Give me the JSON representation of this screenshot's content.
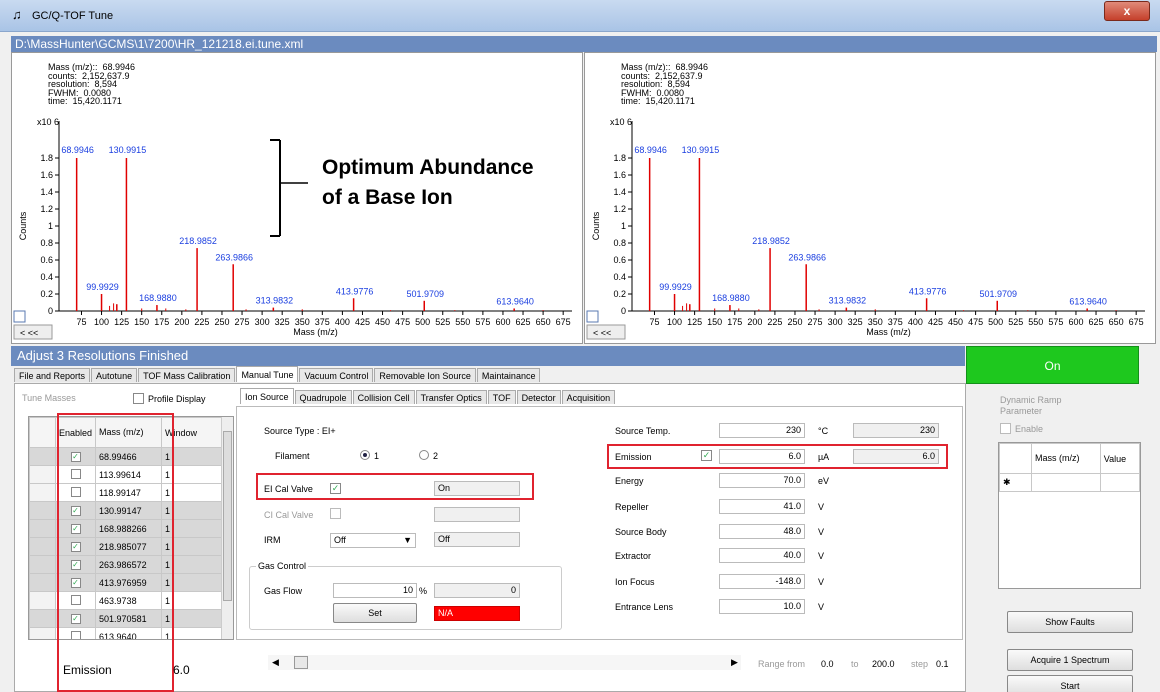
{
  "window": {
    "title": "GC/Q-TOF Tune",
    "file_path": "D:\\MassHunter\\GCMS\\1\\7200\\HR_121218.ei.tune.xml",
    "close_label": "x"
  },
  "annotation": {
    "text_line1": "Optimum Abundance",
    "text_line2": "of a Base Ion"
  },
  "plot_readout": {
    "mass": "Mass (m/z)::  68.9946",
    "counts": "counts:  2,152,637.9",
    "resolution": "resolution:  8,594",
    "fwhm": "FWHM:  0.0080",
    "time": "time:  15,420.1171"
  },
  "chart_data": [
    {
      "type": "bar",
      "xlabel": "Mass (m/z)",
      "ylabel": "Counts",
      "y_multiplier": "x10 6",
      "xlim": [
        47,
        686
      ],
      "ylim": [
        0,
        2.0
      ],
      "xticks": [
        75,
        100,
        125,
        150,
        175,
        200,
        225,
        250,
        275,
        300,
        325,
        350,
        375,
        400,
        425,
        450,
        475,
        500,
        525,
        550,
        575,
        600,
        625,
        650,
        675
      ],
      "yticks": [
        0,
        0.2,
        0.4,
        0.6,
        0.8,
        1,
        1.2,
        1.4,
        1.6,
        1.8
      ],
      "peaks": [
        {
          "x": 68.9946,
          "y": 1.8,
          "label": "68.9946"
        },
        {
          "x": 99.9929,
          "y": 0.2,
          "label": "99.9929"
        },
        {
          "x": 118.99,
          "y": 0.08
        },
        {
          "x": 130.9915,
          "y": 1.8,
          "label": "130.9915"
        },
        {
          "x": 168.988,
          "y": 0.07,
          "label": "168.9880"
        },
        {
          "x": 218.9852,
          "y": 0.74,
          "label": "218.9852"
        },
        {
          "x": 263.9866,
          "y": 0.55,
          "label": "263.9866"
        },
        {
          "x": 313.9832,
          "y": 0.04,
          "label": "313.9832"
        },
        {
          "x": 413.9776,
          "y": 0.15,
          "label": "413.9776"
        },
        {
          "x": 501.9709,
          "y": 0.12,
          "label": "501.9709"
        },
        {
          "x": 613.964,
          "y": 0.03,
          "label": "613.9640"
        }
      ]
    },
    {
      "type": "bar",
      "xlabel": "Mass (m/z)",
      "ylabel": "Counts",
      "y_multiplier": "x10 6",
      "xlim": [
        47,
        686
      ],
      "ylim": [
        0,
        2.0
      ],
      "xticks": [
        75,
        100,
        125,
        150,
        175,
        200,
        225,
        250,
        275,
        300,
        325,
        350,
        375,
        400,
        425,
        450,
        475,
        500,
        525,
        550,
        575,
        600,
        625,
        650,
        675
      ],
      "yticks": [
        0,
        0.2,
        0.4,
        0.6,
        0.8,
        1,
        1.2,
        1.4,
        1.6,
        1.8
      ],
      "peaks": [
        {
          "x": 68.9946,
          "y": 1.8,
          "label": "68.9946"
        },
        {
          "x": 99.9929,
          "y": 0.2,
          "label": "99.9929"
        },
        {
          "x": 118.99,
          "y": 0.08
        },
        {
          "x": 130.9915,
          "y": 1.8,
          "label": "130.9915"
        },
        {
          "x": 168.988,
          "y": 0.07,
          "label": "168.9880"
        },
        {
          "x": 218.9852,
          "y": 0.74,
          "label": "218.9852"
        },
        {
          "x": 263.9866,
          "y": 0.55,
          "label": "263.9866"
        },
        {
          "x": 313.9832,
          "y": 0.04,
          "label": "313.9832"
        },
        {
          "x": 413.9776,
          "y": 0.15,
          "label": "413.9776"
        },
        {
          "x": 501.9709,
          "y": 0.12,
          "label": "501.9709"
        },
        {
          "x": 613.964,
          "y": 0.03,
          "label": "613.9640"
        }
      ]
    }
  ],
  "status": {
    "message": "Adjust 3 Resolutions Finished",
    "on_label": "On"
  },
  "main_tabs": [
    "File and Reports",
    "Autotune",
    "TOF Mass Calibration",
    "Manual Tune",
    "Vacuum Control",
    "Removable Ion Source",
    "Maintainance"
  ],
  "sub_tabs": [
    "Ion Source",
    "Quadrupole",
    "Collision Cell",
    "Transfer Optics",
    "TOF",
    "Detector",
    "Acquisition"
  ],
  "tune_masses": {
    "title": "Tune Masses",
    "profile_display": "Profile Display",
    "headers": {
      "enabled": "Enabled",
      "mass": "Mass (m/z)",
      "window": "Window"
    },
    "rows": [
      {
        "enabled": true,
        "mass": "68.99466",
        "window": "1"
      },
      {
        "enabled": false,
        "mass": "113.99614",
        "window": "1"
      },
      {
        "enabled": false,
        "mass": "118.99147",
        "window": "1"
      },
      {
        "enabled": true,
        "mass": "130.99147",
        "window": "1"
      },
      {
        "enabled": true,
        "mass": "168.988266",
        "window": "1"
      },
      {
        "enabled": true,
        "mass": "218.985077",
        "window": "1"
      },
      {
        "enabled": true,
        "mass": "263.986572",
        "window": "1"
      },
      {
        "enabled": true,
        "mass": "413.976959",
        "window": "1"
      },
      {
        "enabled": false,
        "mass": "463.9738",
        "window": "1"
      },
      {
        "enabled": true,
        "mass": "501.970581",
        "window": "1"
      },
      {
        "enabled": false,
        "mass": "613.9640",
        "window": "1"
      }
    ]
  },
  "ion_source": {
    "source_type": "Source Type : EI+",
    "filament_label": "Filament",
    "filament_opt1": "1",
    "filament_opt2": "2",
    "ei_cal_valve_label": "EI Cal Valve",
    "ei_cal_valve_value": "On",
    "ci_cal_valve_label": "CI Cal Valve",
    "irm_label": "IRM",
    "irm_select": "Off",
    "irm_value": "Off",
    "gas_control": "Gas Control",
    "gas_flow_label": "Gas Flow",
    "gas_flow_value": "10",
    "gas_flow_unit": "%",
    "gas_flow_actual": "0",
    "set_label": "Set",
    "na_label": "N/A"
  },
  "params": [
    {
      "label": "Source Temp.",
      "value": "230",
      "unit": "°C",
      "actual": "230"
    },
    {
      "label": "Emission",
      "value": "6.0",
      "unit": "µA",
      "actual": "6.0"
    },
    {
      "label": "Energy",
      "value": "70.0",
      "unit": "eV"
    },
    {
      "label": "Repeller",
      "value": "41.0",
      "unit": "V"
    },
    {
      "label": "Source Body",
      "value": "48.0",
      "unit": "V"
    },
    {
      "label": "Extractor",
      "value": "40.0",
      "unit": "V"
    },
    {
      "label": "Ion Focus",
      "value": "-148.0",
      "unit": "V"
    },
    {
      "label": "Entrance Lens",
      "value": "10.0",
      "unit": "V"
    }
  ],
  "dynamic_ramp": {
    "title_line1": "Dynamic Ramp",
    "title_line2": "Parameter",
    "enable": "Enable",
    "col_mass": "Mass (m/z)",
    "col_value": "Value",
    "new_row": "✱"
  },
  "buttons": {
    "show_faults": "Show Faults",
    "acquire": "Acquire 1 Spectrum",
    "start": "Start"
  },
  "footer": {
    "emission_label": "Emission",
    "emission_value": "6.0",
    "range_from": "Range from",
    "range_lo": "0.0",
    "range_to": "to",
    "range_hi": "200.0",
    "step_label": "step",
    "step_value": "0.1"
  }
}
